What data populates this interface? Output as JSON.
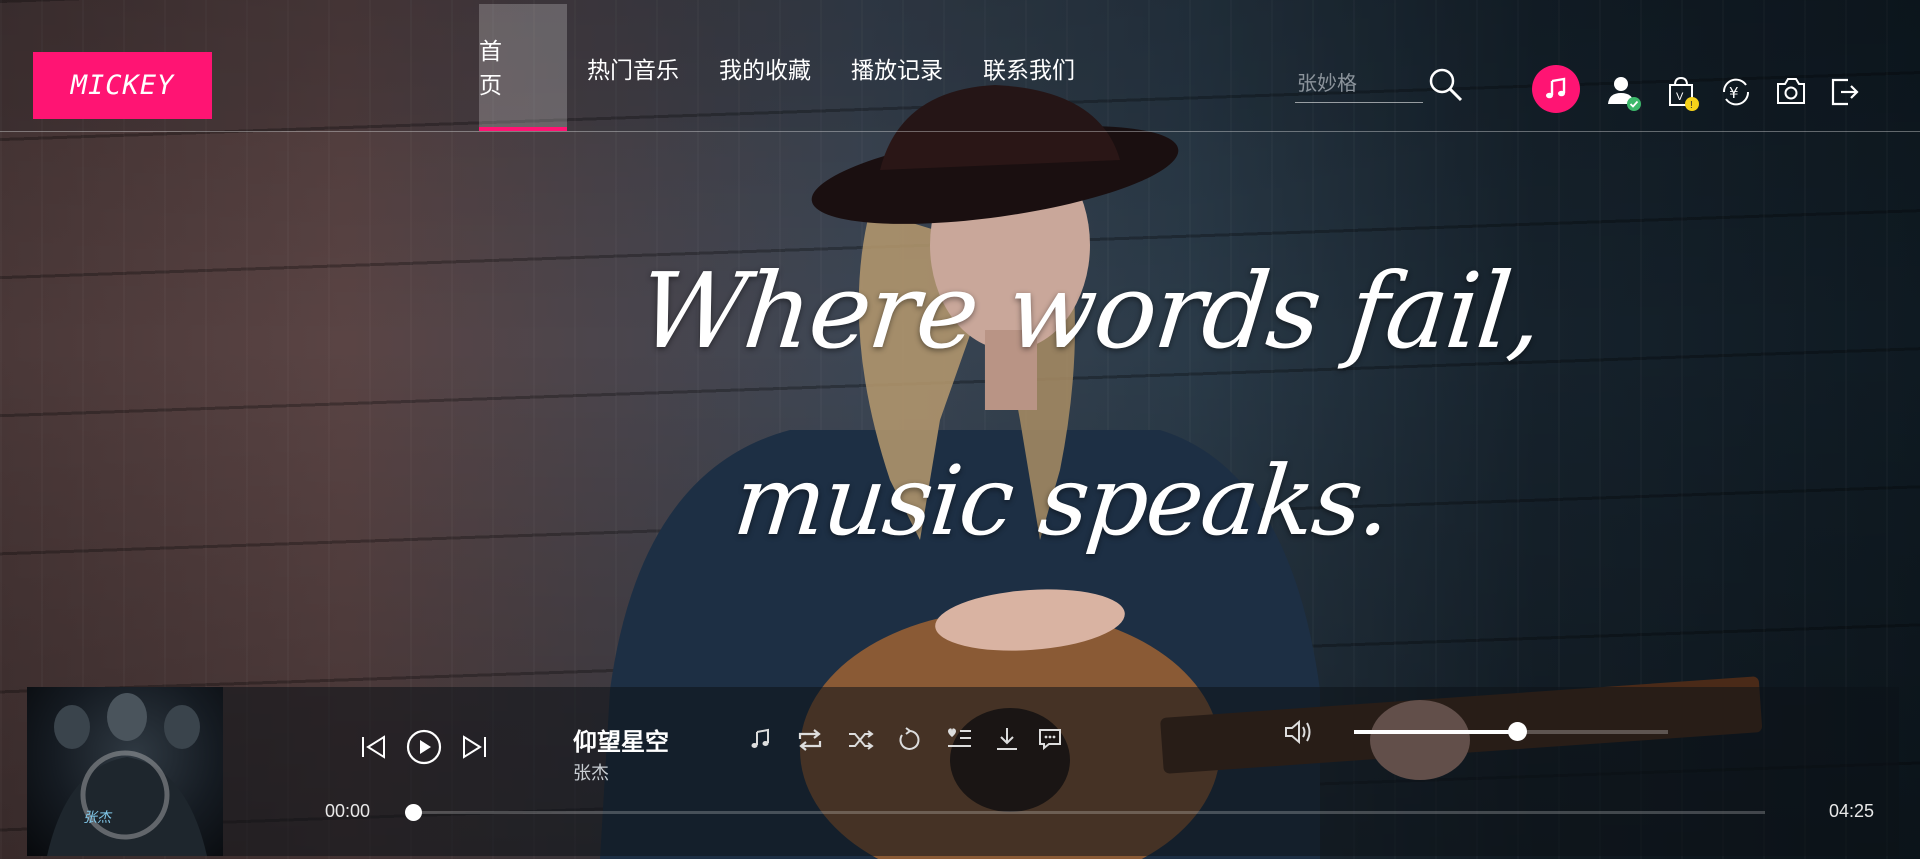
{
  "brand": {
    "logo_text": "MICKEY",
    "accent": "#ff1473"
  },
  "nav": {
    "items": [
      {
        "label": "首　页",
        "active": true
      },
      {
        "label": "热门音乐",
        "active": false
      },
      {
        "label": "我的收藏",
        "active": false
      },
      {
        "label": "播放记录",
        "active": false
      },
      {
        "label": "联系我们",
        "active": false
      }
    ]
  },
  "search": {
    "placeholder": "张妙格",
    "icon": "search-icon"
  },
  "header_icons": [
    "music-note-icon",
    "user-verified-icon",
    "vip-bag-icon",
    "yuan-exchange-icon",
    "camera-icon",
    "logout-icon"
  ],
  "hero": {
    "line1": "Where words fail,",
    "line2": "music speaks."
  },
  "player": {
    "album_art_text": "张杰",
    "song_title": "仰望星空",
    "artist": "张杰",
    "current_time": "00:00",
    "total_time": "04:25",
    "progress": 0.0,
    "volume": 0.52,
    "controls": [
      "previous-icon",
      "play-icon",
      "next-icon"
    ],
    "actions": [
      "lyrics-note-icon",
      "repeat-icon",
      "shuffle-icon",
      "loop-one-icon",
      "add-to-list-icon",
      "download-icon",
      "comment-icon"
    ],
    "volume_icon": "volume-icon"
  }
}
